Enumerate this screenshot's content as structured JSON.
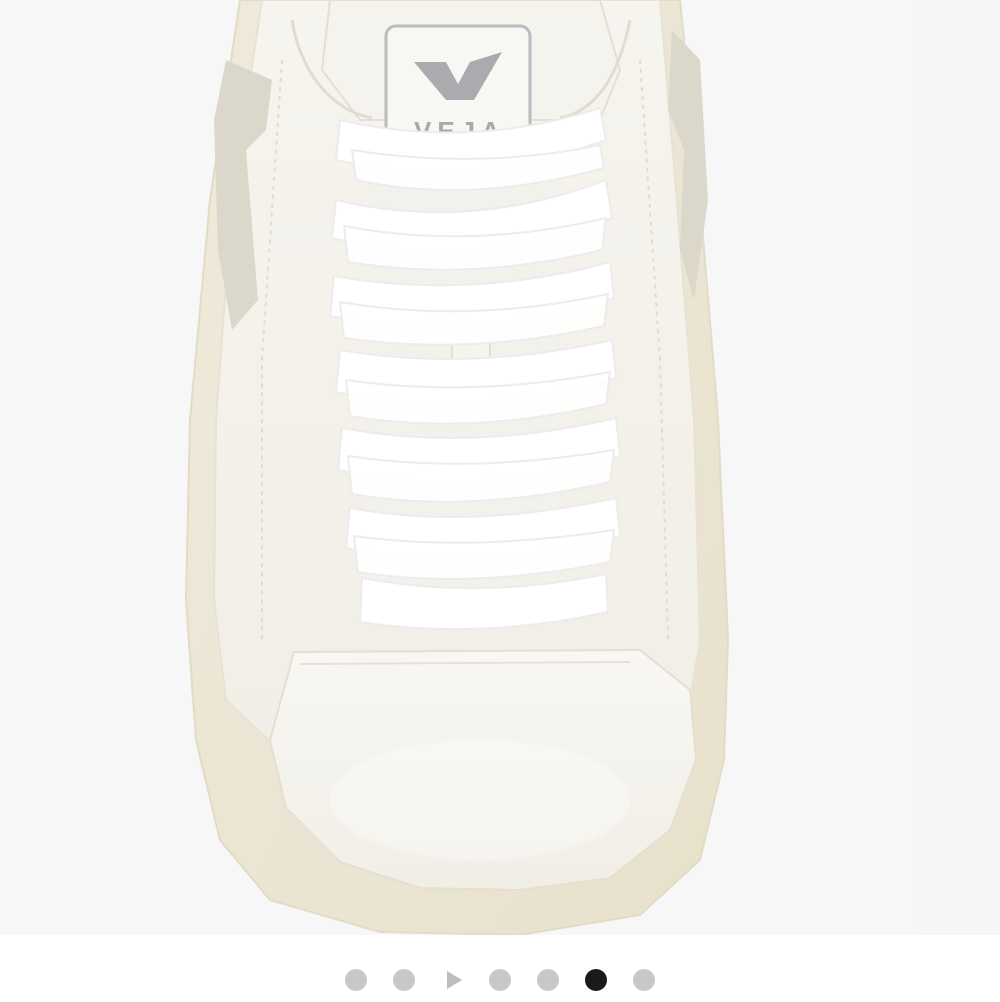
{
  "product_image": {
    "brand_mark": "VEJA",
    "logo_icon": "veja-v-icon",
    "colors": {
      "background": "#f7f7f7",
      "upper": "#f3f1ea",
      "sole": "#ece7d4",
      "suede_panel": "#d9d5cb",
      "laces": "#ffffff",
      "logo": "#a7a9ad"
    }
  },
  "pager": {
    "total": 7,
    "active_index": 5,
    "items": [
      {
        "type": "dot",
        "icon": "dot-icon",
        "active": false
      },
      {
        "type": "dot",
        "icon": "dot-icon",
        "active": false
      },
      {
        "type": "video",
        "icon": "play-icon",
        "active": false
      },
      {
        "type": "dot",
        "icon": "dot-icon",
        "active": false
      },
      {
        "type": "dot",
        "icon": "dot-icon",
        "active": false
      },
      {
        "type": "dot",
        "icon": "dot-icon",
        "active": true
      },
      {
        "type": "dot",
        "icon": "dot-icon",
        "active": false
      }
    ]
  }
}
